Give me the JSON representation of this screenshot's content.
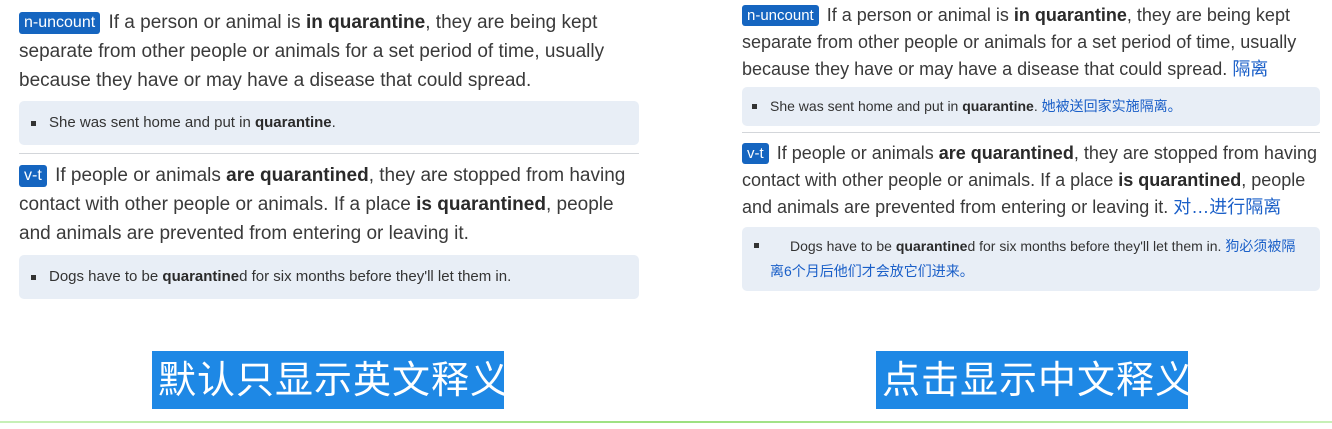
{
  "left": {
    "sense1": {
      "tag": "n-uncount",
      "pre": "If a person or animal is ",
      "bold": "in quarantine",
      "post": ", they are being kept separate from other people or animals for a set period of time, usually because they have or may have a disease that could spread."
    },
    "example1": {
      "pre": "She was sent home and put in ",
      "bold": "quarantine",
      "post": "."
    },
    "sense2": {
      "tag": "v-t",
      "pre": "If people or animals ",
      "bold1": "are quarantined",
      "mid": ", they are stopped from having contact with other people or animals. If a place ",
      "bold2": "is quarantined",
      "post": ", people and animals are prevented from entering or leaving it."
    },
    "example2": {
      "pre": "Dogs have to be ",
      "bold": "quarantine",
      "post": "d for six months before they'll let them in."
    },
    "caption": "默认只显示英文释义"
  },
  "right": {
    "sense1": {
      "tag": "n-uncount",
      "pre": "If a person or animal is ",
      "bold": "in quarantine",
      "post": ", they are being kept separate from other people or animals for a set period of time, usually because they have or may have a disease that could spread. ",
      "cn": "隔离"
    },
    "example1": {
      "pre": "She was sent home and put in ",
      "bold": "quarantine",
      "post": ". ",
      "cn": "她被送回家实施隔离。"
    },
    "sense2": {
      "tag": "v-t",
      "pre": "If people or animals ",
      "bold1": "are quarantined",
      "mid": ", they are stopped from having contact with other people or animals. If a place ",
      "bold2": "is quarantined",
      "post": ", people and animals are prevented from entering or leaving it. ",
      "cn": "对…进行隔离"
    },
    "example2": {
      "pre": "Dogs have to be ",
      "bold": "quarantine",
      "post": "d for six months before they'll let them in. ",
      "cn": "狗必须被隔离6个月后他们才会放它们进来。"
    },
    "caption": "点击显示中文释义"
  },
  "colors": {
    "tag": "#1565c0",
    "caption_bg": "#1e88e5",
    "chinese_text": "#1a5fc8",
    "example_bg": "#e8eef6"
  }
}
